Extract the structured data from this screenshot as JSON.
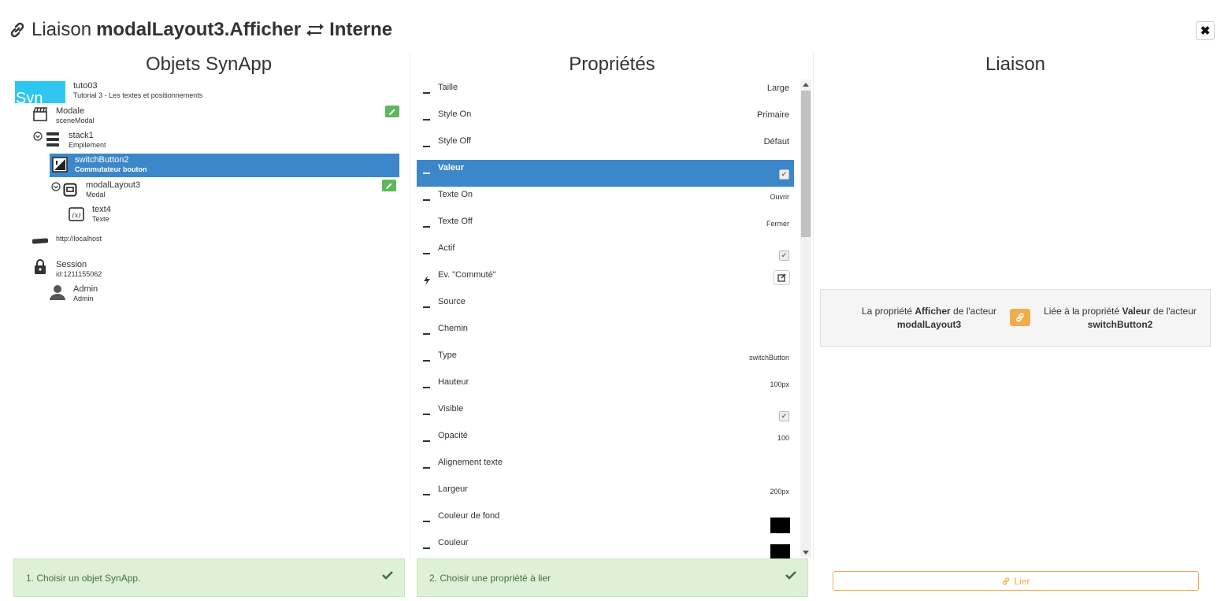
{
  "header": {
    "prefix": "Liaison",
    "actor": "modalLayout3",
    "prop": ".Afficher",
    "target": "Interne"
  },
  "columns": {
    "objects": "Objets SynApp",
    "properties": "Propriétés",
    "binding": "Liaison"
  },
  "tree": {
    "logo_text": "Syn",
    "project": {
      "name": "tuto03",
      "sub": "Tutorial 3 - Les textes et positionnements"
    },
    "modale": {
      "name": "Modale",
      "sub": "sceneModal"
    },
    "stack": {
      "name": "stack1",
      "sub": "Empilement"
    },
    "switch": {
      "name": "switchButton2",
      "sub": "Commutateur bouton"
    },
    "modal": {
      "name": "modalLayout3",
      "sub": "Modal"
    },
    "text": {
      "name": "text4",
      "sub": "Texte"
    },
    "server": {
      "name": "http://localhost"
    },
    "session": {
      "name": "Session",
      "sub": "id:1211155062"
    },
    "user": {
      "name": "Admin",
      "sub": "Admin"
    }
  },
  "properties": [
    {
      "label": "Taille",
      "value": "Large"
    },
    {
      "label": "Style On",
      "value": "Primaire"
    },
    {
      "label": "Style Off",
      "value": "Défaut"
    },
    {
      "label": "Valeur",
      "value": "checked"
    },
    {
      "label": "Texte On",
      "value": "Ouvrir"
    },
    {
      "label": "Texte Off",
      "value": "Fermer"
    },
    {
      "label": "Actif",
      "value": "checked"
    },
    {
      "label": "Ev. \"Commuté\"",
      "value": ""
    },
    {
      "label": "Source",
      "value": ""
    },
    {
      "label": "Chemin",
      "value": ""
    },
    {
      "label": "Type",
      "value": "switchButton"
    },
    {
      "label": "Hauteur",
      "value": "100px"
    },
    {
      "label": "Visible",
      "value": "checked"
    },
    {
      "label": "Opacité",
      "value": "100"
    },
    {
      "label": "Alignement texte",
      "value": ""
    },
    {
      "label": "Largeur",
      "value": "200px"
    },
    {
      "label": "Couleur de fond",
      "value": "#000000"
    },
    {
      "label": "Couleur",
      "value": "#000000"
    }
  ],
  "binding": {
    "left_pre": "La propriété",
    "left_prop": "Afficher",
    "left_mid": "de l'acteur",
    "left_actor": "modalLayout3",
    "right_pre": "Liée à la propriété",
    "right_prop": "Valeur",
    "right_mid": "de l'acteur",
    "right_actor": "switchButton2"
  },
  "footer": {
    "step1": "1. Choisir un objet SynApp.",
    "step2": "2. Choisir une propriété à lier",
    "lier": "Lier"
  },
  "colors": {
    "selection": "#3c87c9",
    "success_bg": "#dff0d8",
    "warning": "#f0ad4e",
    "edit": "#5cb85c"
  }
}
